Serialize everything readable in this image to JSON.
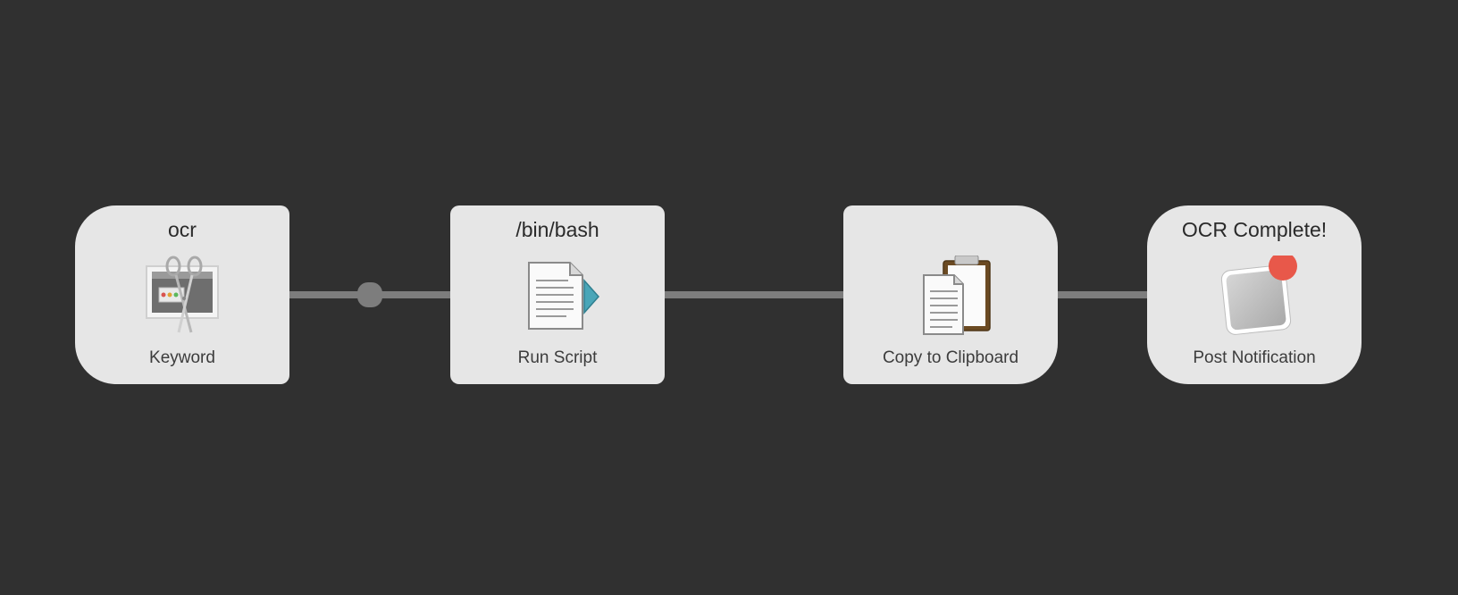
{
  "workflow": {
    "nodes": [
      {
        "title": "ocr",
        "label": "Keyword",
        "icon": "screenshot-scissors-icon"
      },
      {
        "title": "/bin/bash",
        "label": "Run Script",
        "icon": "script-document-icon"
      },
      {
        "title": "",
        "label": "Copy to Clipboard",
        "icon": "clipboard-icon"
      },
      {
        "title": "OCR Complete!",
        "label": "Post Notification",
        "icon": "notification-badge-icon"
      }
    ]
  },
  "colors": {
    "background": "#303030",
    "node": "#e6e6e6",
    "connector": "#7d7d7d",
    "notification_badge": "#e8584a",
    "script_arrow": "#4aa6b8"
  }
}
